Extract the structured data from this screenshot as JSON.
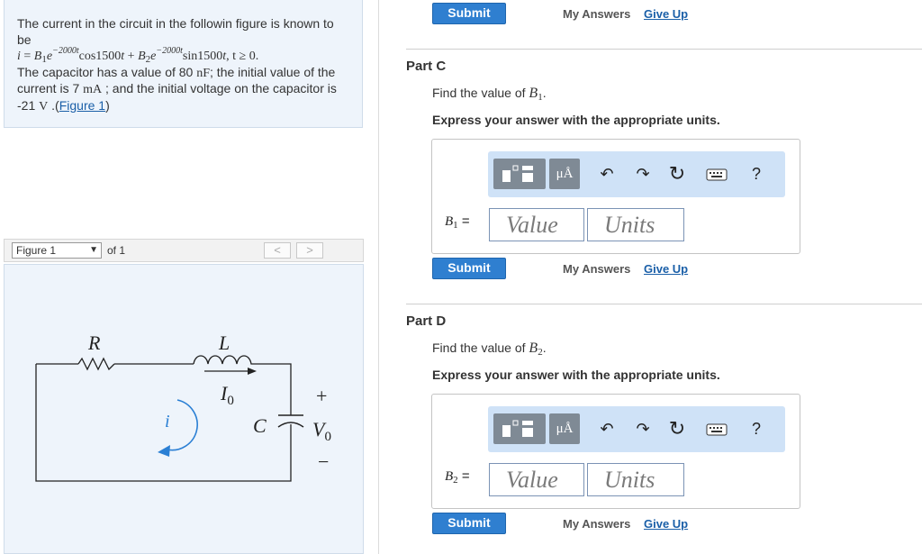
{
  "problem": {
    "intro": "The current in the circuit in the followin figure is known to be",
    "eq": {
      "i": "i",
      "eq": " = ",
      "b1": "B",
      "b1_sub": "1",
      "e1": "e",
      "exp1": "−2000t",
      "cos": "cos1500",
      "t1": "t",
      "plus": " + ",
      "b2": "B",
      "b2_sub": "2",
      "e2": "e",
      "exp2": "−2000t",
      "sin": "sin1500",
      "t2": "t",
      "cond": ", t ≥ 0."
    },
    "cap_pre": "The capacitor has a value of 80 ",
    "cap_unit": "nF",
    "cap_post": "; the initial value of the current is 7 ",
    "cur_unit": "mA",
    "cur_post": " ; and the initial voltage on the capacitor is -21 ",
    "volt_unit": "V",
    "volt_post": " .(",
    "figure_link": "Figure 1",
    "close": ")"
  },
  "figure_nav": {
    "select_value": "Figure 1",
    "caret": "▼",
    "of_text": "of 1",
    "prev": "<",
    "next": ">"
  },
  "circuit": {
    "R": "R",
    "L": "L",
    "I0": "I",
    "I0_sub": "0",
    "C": "C",
    "V0": "V",
    "V0_sub": "0",
    "i": "i",
    "plus": "+",
    "minus": "−"
  },
  "top_actions": {
    "submit": "Submit",
    "my_answers": "My Answers",
    "give_up": "Give Up"
  },
  "part_c": {
    "title": "Part C",
    "find": "Find the value of ",
    "var": "B",
    "var_sub": "1",
    "period": ".",
    "express": "Express your answer with the appropriate units.",
    "label_var": "B",
    "label_sub": "1",
    "label_eq": " =",
    "value_placeholder": "Value",
    "units_placeholder": "Units",
    "submit": "Submit",
    "my_answers": "My Answers",
    "give_up": "Give Up"
  },
  "part_d": {
    "title": "Part D",
    "find": "Find the value of ",
    "var": "B",
    "var_sub": "2",
    "period": ".",
    "express": "Express your answer with the appropriate units.",
    "label_var": "B",
    "label_sub": "2",
    "label_eq": " =",
    "value_placeholder": "Value",
    "units_placeholder": "Units",
    "submit": "Submit",
    "my_answers": "My Answers",
    "give_up": "Give Up"
  },
  "toolbar": {
    "units_btn": "μÅ",
    "undo": "↶",
    "redo": "↷",
    "reset": "↻",
    "keyboard_icon": "keyboard-icon",
    "help": "?"
  },
  "colors": {
    "submit_blue": "#2f7fd0",
    "toolbar_bg": "#cfe2f7",
    "panel_bg": "#eef4fb",
    "link": "#1a5fa8",
    "current_arrow": "#2a7fd4"
  }
}
